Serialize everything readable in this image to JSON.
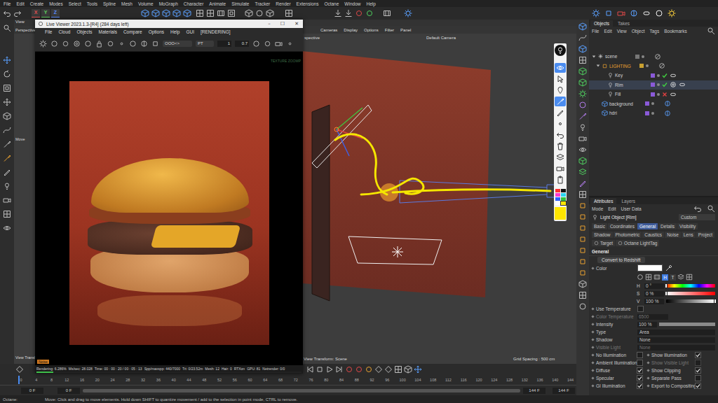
{
  "menubar": [
    "File",
    "Edit",
    "Create",
    "Modes",
    "Select",
    "Tools",
    "Spline",
    "Mesh",
    "Volume",
    "MoGraph",
    "Character",
    "Animate",
    "Simulate",
    "Tracker",
    "Render",
    "Extensions",
    "Octane",
    "Window",
    "Help"
  ],
  "toolbar": {
    "axes": [
      {
        "label": "X",
        "color": "#e05050"
      },
      {
        "label": "Y",
        "color": "#5fd05f"
      },
      {
        "label": "Z",
        "color": "#5a8cff"
      }
    ]
  },
  "viewport": {
    "panel_title": "View",
    "camera_short": "Perspective",
    "menu": [
      "Cameras",
      "Display",
      "Options",
      "Filter",
      "Panel"
    ],
    "camera_cut": "spective",
    "camera_name": "Default Camera",
    "tool_hint": "Move",
    "transform_cut": "View Transf",
    "transform": "View Transform: Scene",
    "grid": "Grid Spacing : 500 cm",
    "annotation": {
      "tools": [
        {
          "selected": true
        },
        {
          "selected": false
        },
        {
          "selected": false
        },
        {
          "selected": true
        },
        {
          "selected": false
        },
        {
          "selected": false
        },
        {
          "selected": false
        },
        {
          "selected": false
        },
        {
          "selected": false
        },
        {
          "selected": false
        },
        {
          "selected": false
        }
      ],
      "palette": [
        {
          "color": "#ff3030",
          "selected": false
        },
        {
          "color": "#111111",
          "selected": false
        },
        {
          "color": "#ff3ad0",
          "selected": false
        },
        {
          "color": "#2bd4f0",
          "selected": false
        },
        {
          "color": "#3060ff",
          "selected": false
        },
        {
          "color": "#30c040",
          "selected": false
        },
        {
          "color": "#ffffff",
          "selected": false
        },
        {
          "color": "#ffe600",
          "selected": true
        }
      ]
    }
  },
  "live_viewer": {
    "title": "Live Viewer 2023.1.3-[R4] (284 days left)",
    "window_buttons": [
      "–",
      "☐",
      "✕"
    ],
    "menu": [
      "File",
      "Cloud",
      "Objects",
      "Materials",
      "Compare",
      "Options",
      "Help",
      "GUI",
      "[RENDERING]"
    ],
    "kernel_mode": "OOO<>",
    "kernel": "PT",
    "max_samples": "1",
    "gamma": "0.7",
    "overlay": "TEXTURE ZOOMP",
    "status": [
      "Rendering: 6.286%",
      "Ms/sec: 28.028",
      "Time: 00 : 00 : 20 / 00 : 05 : 13",
      "Spp/maxspp: 440/7000",
      "Tri: 0/23.52m",
      "Mesh: 12",
      "Hair: 0",
      "RTXon",
      "GPU: 81",
      "Netrender: 0/0"
    ],
    "progress": 0.063,
    "badge": "Noise"
  },
  "objects": {
    "tabs": [
      {
        "label": "Objects",
        "selected": true
      },
      {
        "label": "Takes",
        "selected": false
      }
    ],
    "menu": [
      "File",
      "Edit",
      "View",
      "Object",
      "Tags",
      "Bookmarks"
    ],
    "root": {
      "name": "scene",
      "expanded": true
    },
    "group": {
      "name": "LIGHTING",
      "expanded": true
    },
    "lights": [
      {
        "name": "Key",
        "enabled": true,
        "selected": false,
        "has_target": false
      },
      {
        "name": "Rim",
        "enabled": true,
        "selected": true,
        "has_target": true
      },
      {
        "name": "Fill",
        "enabled": false,
        "selected": false,
        "has_target": false
      }
    ],
    "items": [
      {
        "name": "background",
        "selected": false
      },
      {
        "name": "hdri",
        "selected": false
      }
    ]
  },
  "attributes": {
    "tabs": [
      {
        "label": "Attributes",
        "selected": true
      },
      {
        "label": "Layers",
        "selected": false
      }
    ],
    "menu": [
      "Mode",
      "Edit",
      "User Data"
    ],
    "object": "Light Object [Rim]",
    "preset": "Custom",
    "pages": [
      [
        {
          "label": "Basic",
          "selected": false
        },
        {
          "label": "Coordinates",
          "selected": false
        },
        {
          "label": "General",
          "selected": true
        },
        {
          "label": "Details",
          "selected": false
        },
        {
          "label": "Visibility",
          "selected": false
        }
      ],
      [
        {
          "label": "Shadow",
          "selected": false
        },
        {
          "label": "Photometric",
          "selected": false
        },
        {
          "label": "Caustics",
          "selected": false
        },
        {
          "label": "Noise",
          "selected": false
        },
        {
          "label": "Lens",
          "selected": false
        },
        {
          "label": "Project",
          "selected": false
        }
      ]
    ],
    "tag_pages": [
      {
        "label": "Target",
        "selected": false
      },
      {
        "label": "Octane LightTag",
        "selected": false
      }
    ],
    "section": "General",
    "convert": "Convert to Redshift",
    "color": {
      "label": "Color",
      "value": "#ffffff"
    },
    "color_modes": [
      {
        "label": "H",
        "selected": true
      },
      {
        "label": "T",
        "selected": false
      }
    ],
    "hsv": [
      {
        "label": "H",
        "reading": "0 °",
        "level": 0,
        "kind": "hue"
      },
      {
        "label": "S",
        "reading": "0 %",
        "level": 0,
        "kind": "saturation"
      },
      {
        "label": "V",
        "reading": "100 %",
        "level": 1,
        "kind": "value"
      }
    ],
    "fields": [
      {
        "kind": "check",
        "label": "Use Temperature",
        "checked": false,
        "disabled": false
      },
      {
        "kind": "number",
        "label": "Color Temperature",
        "value": "6500",
        "disabled": true
      },
      {
        "kind": "slider",
        "label": "Intensity",
        "value": "100 %",
        "level": 1,
        "disabled": false
      },
      {
        "kind": "select",
        "label": "Type",
        "value": "Area",
        "disabled": false
      },
      {
        "kind": "select",
        "label": "Shadow",
        "value": "None",
        "disabled": false
      },
      {
        "kind": "select",
        "label": "Visible Light",
        "value": "None",
        "disabled": true
      }
    ],
    "check_rows": [
      {
        "left": {
          "label": "No Illumination",
          "checked": false,
          "disabled": false
        },
        "right": {
          "label": "Show Illumination",
          "checked": true,
          "disabled": false
        }
      },
      {
        "left": {
          "label": "Ambient Illumination",
          "checked": false,
          "disabled": false
        },
        "right": {
          "label": "Show Visible Light",
          "checked": false,
          "disabled": true
        }
      },
      {
        "left": {
          "label": "Diffuse",
          "checked": true,
          "disabled": false
        },
        "right": {
          "label": "Show Clipping",
          "checked": true,
          "disabled": false
        }
      },
      {
        "left": {
          "label": "Specular",
          "checked": true,
          "disabled": false
        },
        "right": {
          "label": "Separate Pass",
          "checked": false,
          "disabled": false
        }
      },
      {
        "left": {
          "label": "GI Illumination",
          "checked": true,
          "disabled": false
        },
        "right": {
          "label": "Export to Compositing",
          "checked": true,
          "disabled": false
        }
      }
    ]
  },
  "timeline": {
    "ticks": [
      "0",
      "4",
      "8",
      "12",
      "16",
      "20",
      "24",
      "28",
      "32",
      "36",
      "40",
      "44",
      "48",
      "52",
      "56",
      "60",
      "64",
      "68",
      "72",
      "76",
      "80",
      "84",
      "88",
      "92",
      "96",
      "100",
      "104",
      "108",
      "112",
      "116",
      "120",
      "124",
      "128",
      "132",
      "136",
      "140",
      "144"
    ],
    "start": "0 F",
    "preview_start": "0 F",
    "preview_end": "144 F",
    "end": "144 F",
    "playhead": 0
  },
  "status": {
    "label": "Octane:",
    "message": "Move: Click and drag to move elements. Hold down SHIFT to quantize movement / add to the selection in point mode, CTRL to remove."
  }
}
